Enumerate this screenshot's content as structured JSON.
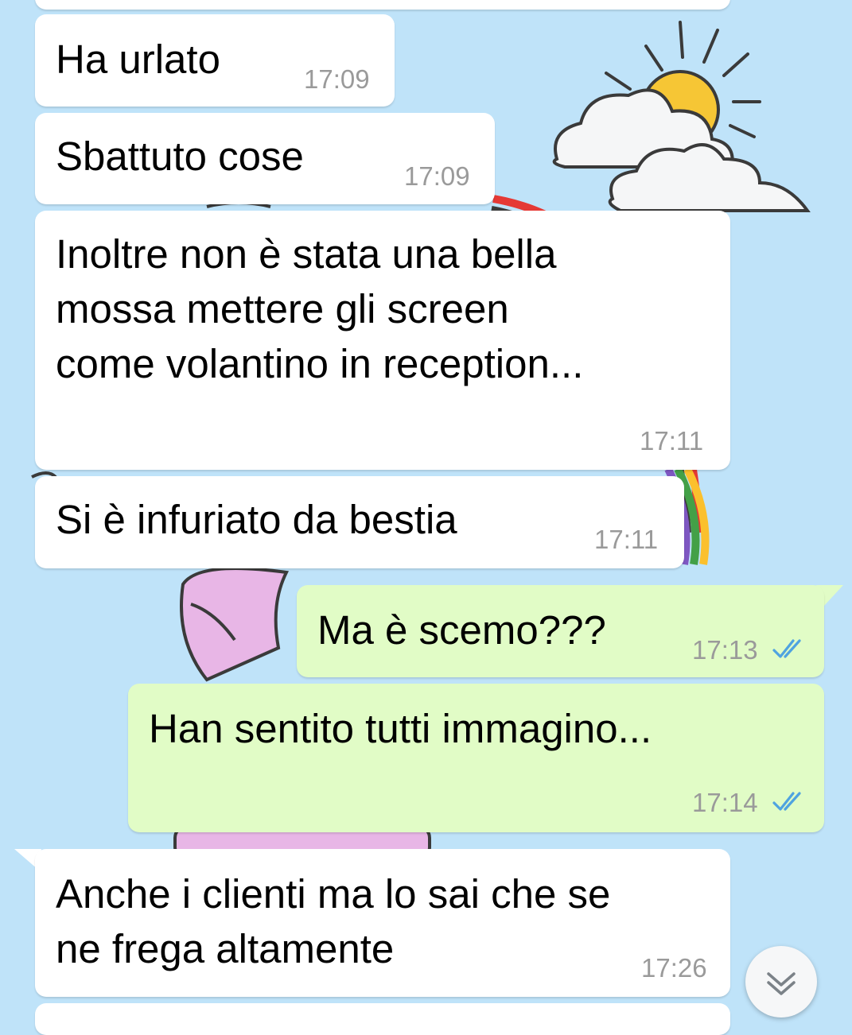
{
  "messages": [
    {
      "direction": "in",
      "text": "Ha urlato",
      "time": "17:09"
    },
    {
      "direction": "in",
      "text": "Sbattuto cose",
      "time": "17:09"
    },
    {
      "direction": "in",
      "text": "Inoltre non è stata una bella\nmossa mettere gli screen\ncome volantino in reception...",
      "time": "17:11"
    },
    {
      "direction": "in",
      "text": "Si è infuriato da bestia",
      "time": "17:11"
    },
    {
      "direction": "out",
      "text": "Ma è scemo???",
      "time": "17:13",
      "status": "read-double-check-icon"
    },
    {
      "direction": "out",
      "text": "Han sentito tutti immagino...",
      "time": "17:14",
      "status": "read-double-check-icon"
    },
    {
      "direction": "in",
      "text": "Anche i clienti ma lo sai che se\nne frega altamente",
      "time": "17:26"
    }
  ],
  "scroll_button": {
    "icon": "double-chevron-down-icon"
  },
  "colors": {
    "background": "#bfe3f9",
    "incoming_bubble": "#ffffff",
    "outgoing_bubble": "#e1fcc6",
    "read_ticks": "#4fa3e0",
    "timestamp": "#9a9a9a"
  }
}
